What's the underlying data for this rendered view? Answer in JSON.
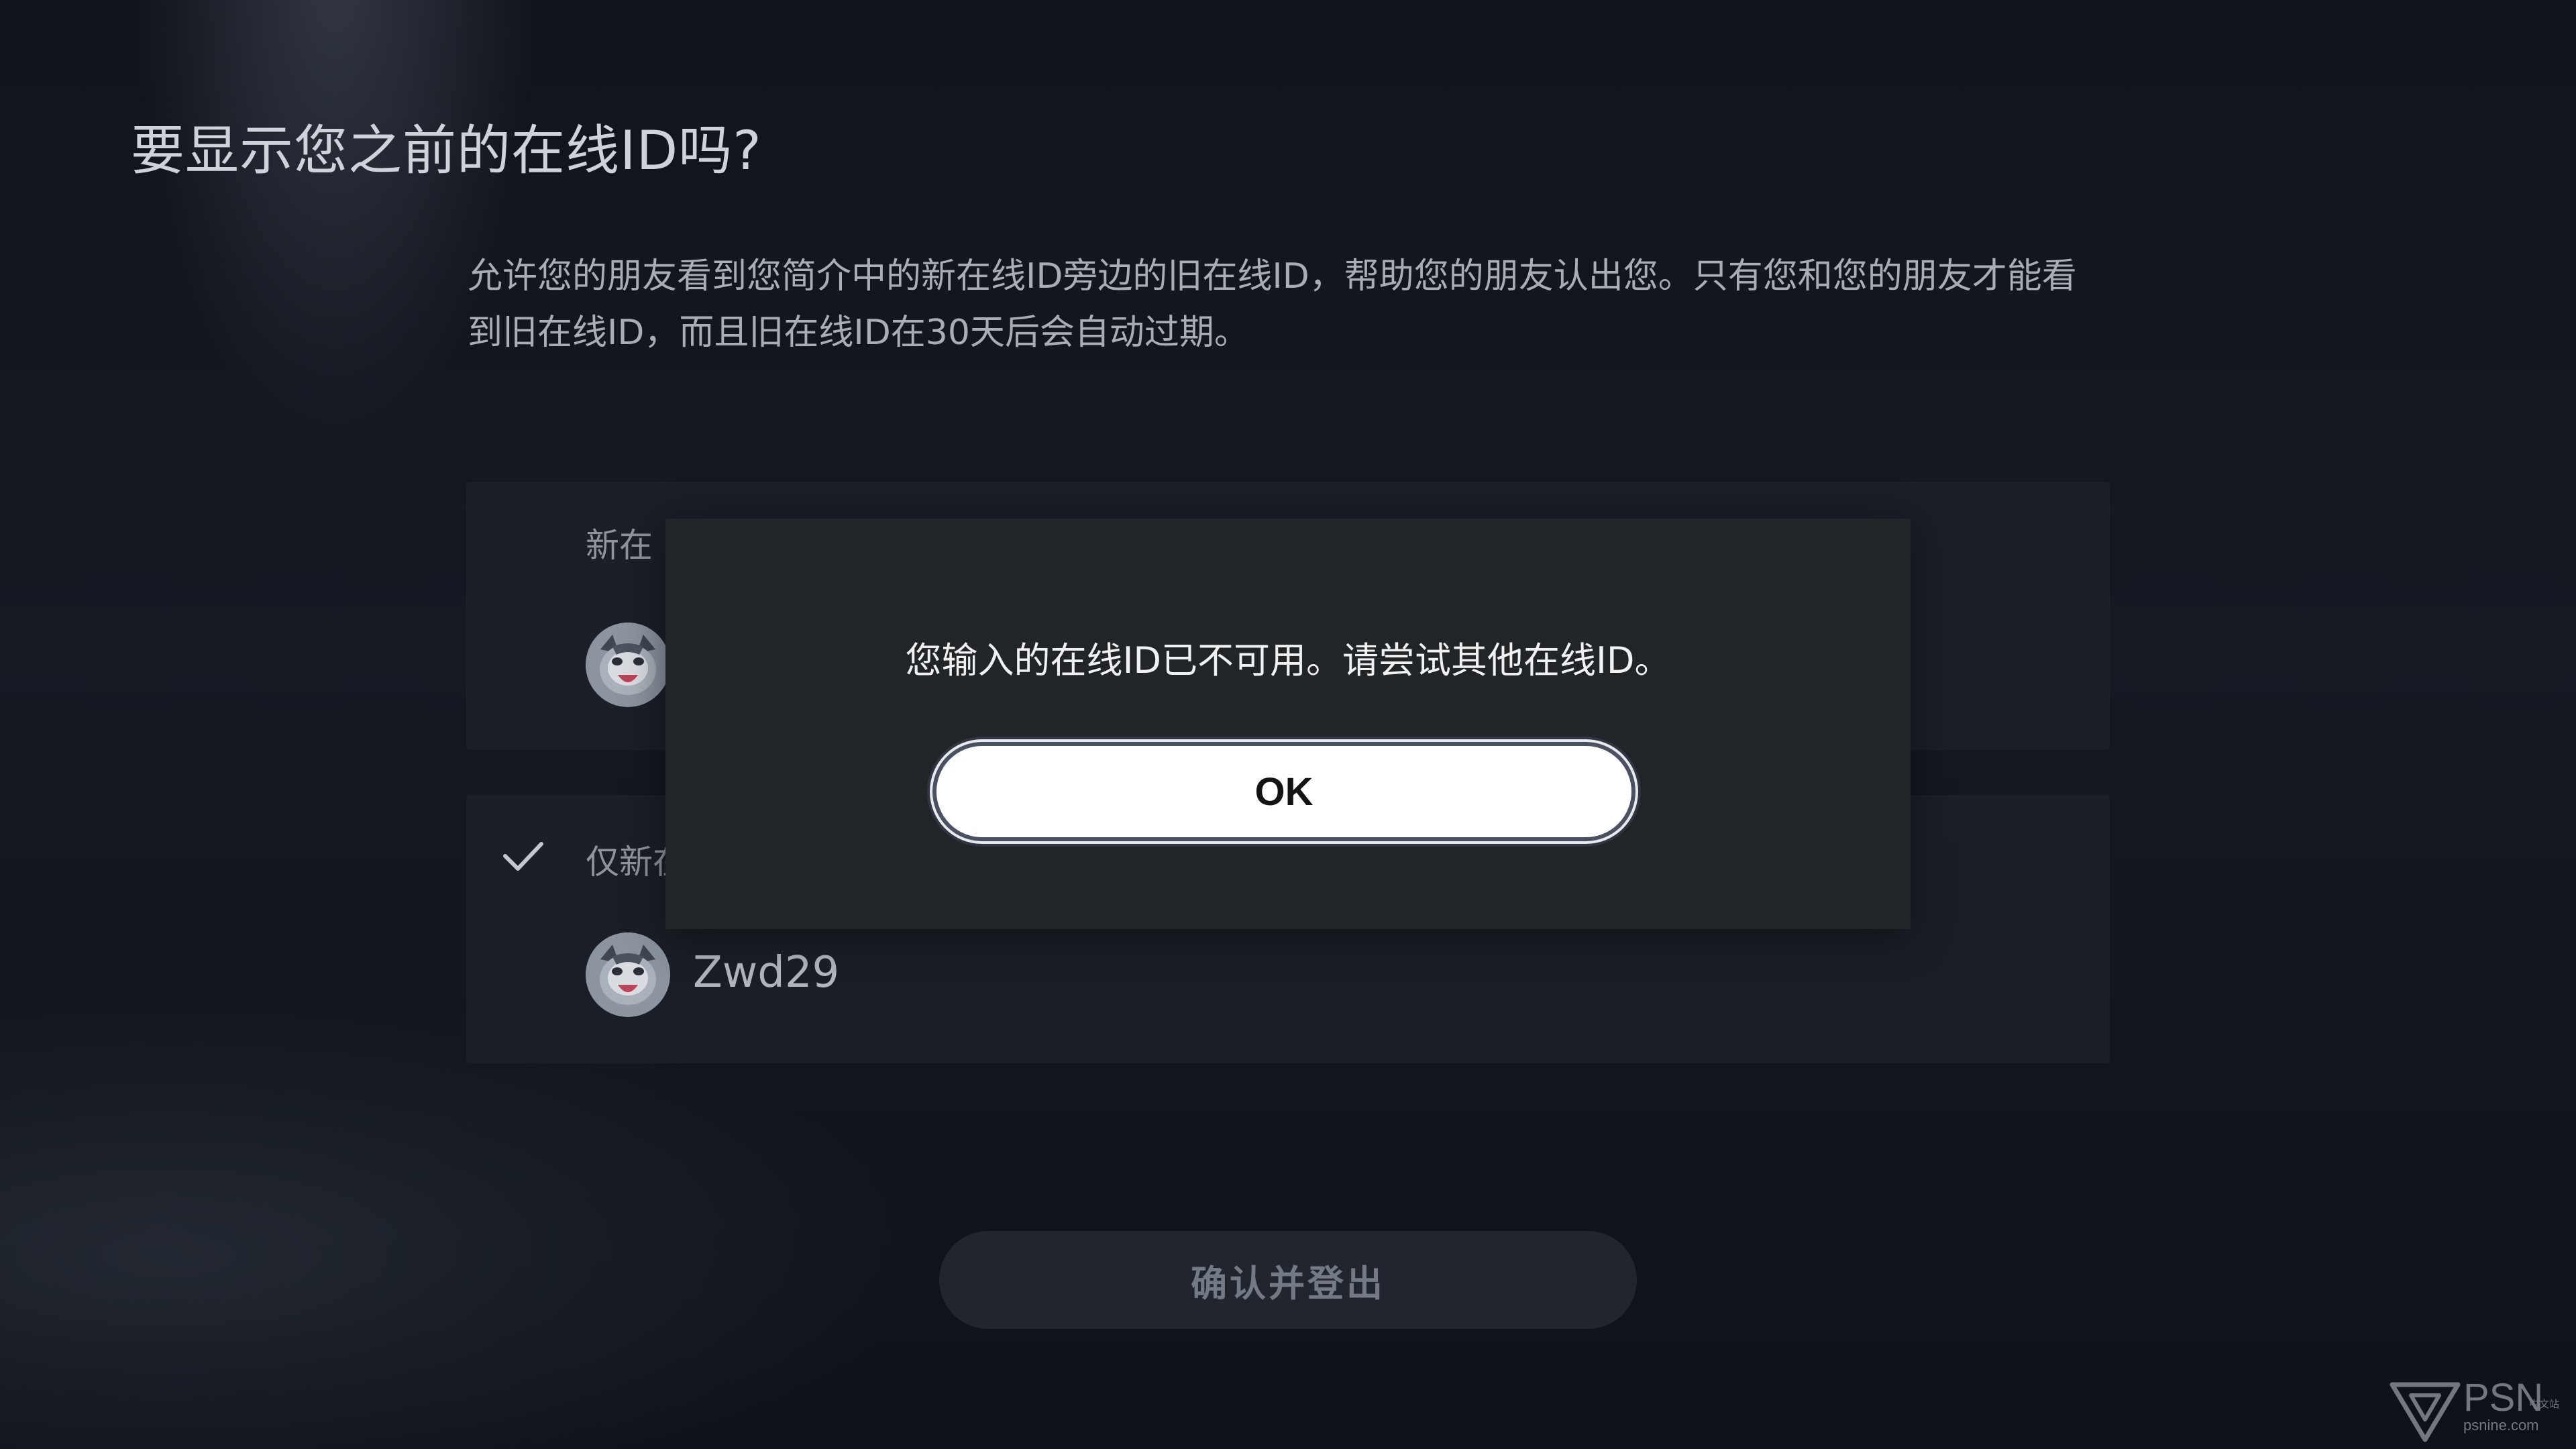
{
  "screen": {
    "title": "要显示您之前的在线ID吗?",
    "description": "允许您的朋友看到您简介中的新在线ID旁边的旧在线ID，帮助您的朋友认出您。只有您和您的朋友才能看到旧在线ID，而且旧在线ID在30天后会自动过期。"
  },
  "options": [
    {
      "label": "新在线ID旁显示旧在线ID",
      "visible_label": "新在",
      "selected": false,
      "online_id": ""
    },
    {
      "label": "仅新在线ID",
      "visible_label": "仅新在",
      "selected": true,
      "online_id": "Zwd29"
    }
  ],
  "dialog": {
    "message": "您输入的在线ID已不可用。请尝试其他在线ID。",
    "ok_label": "OK"
  },
  "footer": {
    "confirm_label": "确认并登出"
  },
  "watermark": {
    "brand": "PSN",
    "cn": "中文站",
    "url": "psnine.com"
  },
  "colors": {
    "background": "#12161e",
    "dialog": "#222528",
    "card": "#1c212a",
    "ok_button": "#ffffff",
    "focus_ring": "#4a5262"
  },
  "icons": {
    "selected_check": "check-icon",
    "avatar": "cat-avatar-icon",
    "logo": "psnine-logo-icon"
  }
}
